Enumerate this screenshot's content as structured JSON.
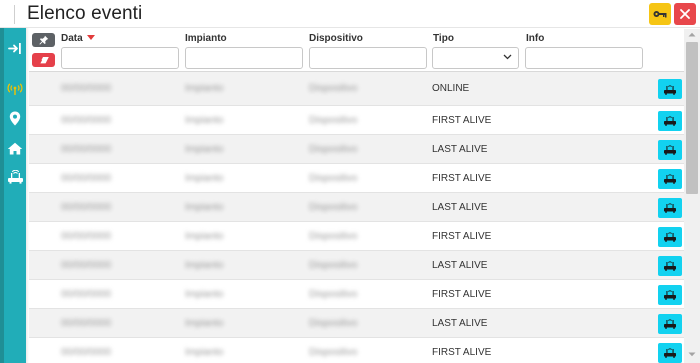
{
  "title": "Elenco eventi",
  "colors": {
    "sidebar": "#21adb8",
    "accent_cyan": "#12d2f0",
    "key_button": "#f6c514",
    "close_button": "#e8474b",
    "eraser_button": "#e5404a",
    "pin_button": "#5d6165"
  },
  "toolbar": {
    "key_icon": "key-icon",
    "close_icon": "close-icon"
  },
  "sidebar": {
    "items": [
      {
        "icon": "logout-icon"
      },
      {
        "icon": "antenna-icon"
      },
      {
        "icon": "map-pin-icon"
      },
      {
        "icon": "home-icon"
      },
      {
        "icon": "router-icon"
      }
    ]
  },
  "table": {
    "columns": {
      "data": "Data",
      "impianto": "Impianto",
      "dispositivo": "Dispositivo",
      "tipo": "Tipo",
      "info": "Info"
    },
    "sort": "desc",
    "filters": {
      "data": "",
      "impianto": "",
      "dispositivo": "",
      "tipo": "",
      "info": ""
    },
    "rows": [
      {
        "data": "00/00/0000",
        "impianto": "Impianto",
        "dispositivo": "Dispositivo",
        "tipo": "ONLINE"
      },
      {
        "data": "00/00/0000",
        "impianto": "Impianto",
        "dispositivo": "Dispositivo",
        "tipo": "FIRST ALIVE"
      },
      {
        "data": "00/00/0000",
        "impianto": "Impianto",
        "dispositivo": "Dispositivo",
        "tipo": "LAST ALIVE"
      },
      {
        "data": "00/00/0000",
        "impianto": "Impianto",
        "dispositivo": "Dispositivo",
        "tipo": "FIRST ALIVE"
      },
      {
        "data": "00/00/0000",
        "impianto": "Impianto",
        "dispositivo": "Dispositivo",
        "tipo": "LAST ALIVE"
      },
      {
        "data": "00/00/0000",
        "impianto": "Impianto",
        "dispositivo": "Dispositivo",
        "tipo": "FIRST ALIVE"
      },
      {
        "data": "00/00/0000",
        "impianto": "Impianto",
        "dispositivo": "Dispositivo",
        "tipo": "LAST ALIVE"
      },
      {
        "data": "00/00/0000",
        "impianto": "Impianto",
        "dispositivo": "Dispositivo",
        "tipo": "FIRST ALIVE"
      },
      {
        "data": "00/00/0000",
        "impianto": "Impianto",
        "dispositivo": "Dispositivo",
        "tipo": "LAST ALIVE"
      },
      {
        "data": "00/00/0000",
        "impianto": "Impianto",
        "dispositivo": "Dispositivo",
        "tipo": "FIRST ALIVE"
      }
    ]
  }
}
